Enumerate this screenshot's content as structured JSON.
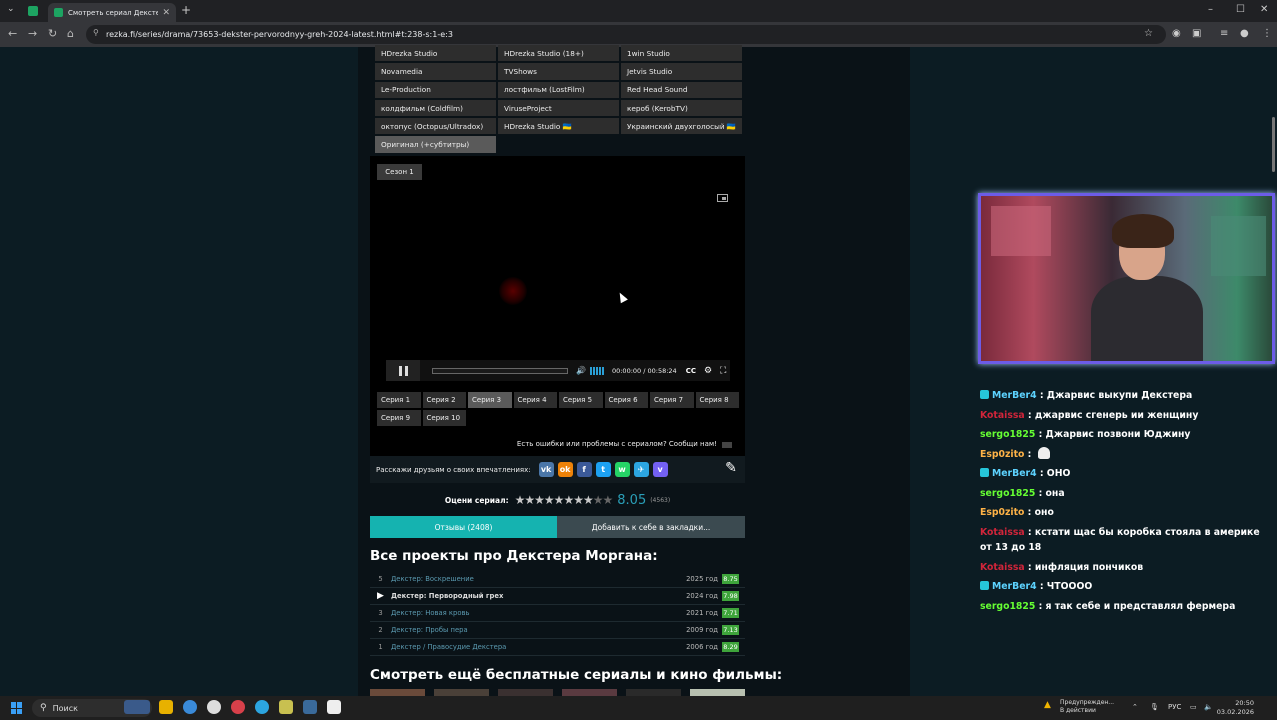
{
  "browser": {
    "tab_title": "Смотреть сериал Декстер...",
    "tab_close": "✕",
    "new_tab": "+",
    "url": "rezka.fi/series/drama/73653-dekster-pervorodnyy-greh-2024-latest.html#t:238-s:1-e:3",
    "win_min": "–",
    "win_max": "☐",
    "win_close": "✕"
  },
  "translators": [
    "HDrezka Studio",
    "HDrezka Studio (18+)",
    "1win Studio",
    "Novamedia",
    "TVShows",
    "Jetvis Studio",
    "Le-Production",
    "лостфильм (LostFilm)",
    "Red Head Sound",
    "колдфильм (Coldfilm)",
    "ViruseProject",
    "кероб (KerobTV)",
    "октопус (Octopus/Ultradox)",
    "HDrezka Studio 🇺🇦",
    "Украинский двухголосый 🇺🇦",
    "Оригинал (+субтитры)"
  ],
  "player": {
    "season": "Сезон 1",
    "time": "00:00:00 / 00:58:24",
    "cc": "CC",
    "report": "Есть ошибки или проблемы с сериалом? Сообщи нам!"
  },
  "episodes": [
    "Серия 1",
    "Серия 2",
    "Серия 3",
    "Серия 4",
    "Серия 5",
    "Серия 6",
    "Серия 7",
    "Серия 8",
    "Серия 9",
    "Серия 10"
  ],
  "active_episode": "Серия 3",
  "share": {
    "label": "Расскажи друзьям о своих впечатлениях:",
    "networks": [
      {
        "name": "vk-icon",
        "glyph": "vk",
        "color": "#4a76a8"
      },
      {
        "name": "ok-icon",
        "glyph": "ok",
        "color": "#ee8208"
      },
      {
        "name": "facebook-icon",
        "glyph": "f",
        "color": "#3b5998"
      },
      {
        "name": "twitter-icon",
        "glyph": "t",
        "color": "#1da1f2"
      },
      {
        "name": "whatsapp-icon",
        "glyph": "w",
        "color": "#25d366"
      },
      {
        "name": "telegram-icon",
        "glyph": "✈",
        "color": "#2ca5e0"
      },
      {
        "name": "viber-icon",
        "glyph": "v",
        "color": "#7360f2"
      }
    ]
  },
  "rating": {
    "label": "Оцени сериал:",
    "value": "8.05",
    "count": "(4563)",
    "stars_filled": 8,
    "stars_total": 10
  },
  "buttons": {
    "reviews": "Отзывы (2408)",
    "bookmark": "Добавить к себе в закладки..."
  },
  "franchise": {
    "title": "Все проекты про Декстера Моргана:",
    "items": [
      {
        "num": "5",
        "title": "Декстер: Воскрешение",
        "year": "2025 год",
        "score": "8.75",
        "current": false
      },
      {
        "num": "▶",
        "title": "Декстер: Первородный грех",
        "year": "2024 год",
        "score": "7.98",
        "current": true
      },
      {
        "num": "3",
        "title": "Декстер: Новая кровь",
        "year": "2021 год",
        "score": "7.71",
        "current": false
      },
      {
        "num": "2",
        "title": "Декстер: Пробы пера",
        "year": "2009 год",
        "score": "7.13",
        "current": false
      },
      {
        "num": "1",
        "title": "Декстер / Правосудие Декстера",
        "year": "2006 год",
        "score": "8.29",
        "current": false
      }
    ]
  },
  "more_title": "Смотреть ещё бесплатные сериалы и кино фильмы:",
  "chat": [
    {
      "user": "MerBer4",
      "color": "#5dd3ff",
      "badge": true,
      "text": "Джарвис выкупи Декстера",
      "emote": false
    },
    {
      "user": "Kotaissa",
      "color": "#d1253a",
      "badge": false,
      "text": "джарвис сгенерь ии женщину",
      "emote": false
    },
    {
      "user": "sergo1825",
      "color": "#66ff33",
      "badge": false,
      "text": "Джарвис позвони Юджину",
      "emote": false
    },
    {
      "user": "Esp0zito",
      "color": "#ffb347",
      "badge": false,
      "text": "",
      "emote": true
    },
    {
      "user": "MerBer4",
      "color": "#5dd3ff",
      "badge": true,
      "text": "ОНО",
      "emote": false
    },
    {
      "user": "sergo1825",
      "color": "#66ff33",
      "badge": false,
      "text": "она",
      "emote": false
    },
    {
      "user": "Esp0zito",
      "color": "#ffb347",
      "badge": false,
      "text": "оно",
      "emote": false
    },
    {
      "user": "Kotaissa",
      "color": "#d1253a",
      "badge": false,
      "text": "кстати щас бы коробка стояла в америке от 13 до 18",
      "emote": false
    },
    {
      "user": "Kotaissa",
      "color": "#d1253a",
      "badge": false,
      "text": "инфляция пончиков",
      "emote": false
    },
    {
      "user": "MerBer4",
      "color": "#5dd3ff",
      "badge": true,
      "text": "ЧТОООО",
      "emote": false
    },
    {
      "user": "sergo1825",
      "color": "#66ff33",
      "badge": false,
      "text": "я так себе и представлял фермера",
      "emote": false
    }
  ],
  "taskbar": {
    "search": "Поиск",
    "notice_title": "Предупрежден...",
    "notice_sub": "В действии",
    "lang": "РУС",
    "time": "20:50",
    "date": "03.02.2026"
  }
}
